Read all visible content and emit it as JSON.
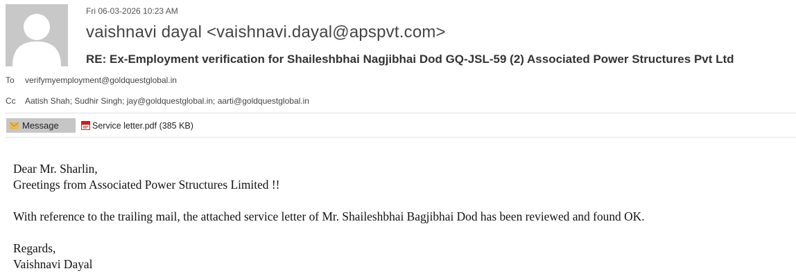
{
  "email": {
    "date": "Fri 06-03-2026 10:23 AM",
    "sender": "vaishnavi dayal <vaishnavi.dayal@apspvt.com>",
    "subject": "RE: Ex-Employment verification for Shaileshbhai Nagjibhai Dod GQ-JSL-59 (2) Associated Power Structures Pvt Ltd",
    "to_label": "To",
    "to": "verifymyemployment@goldquestglobal.in",
    "cc_label": "Cc",
    "cc": "Aatish Shah; Sudhir Singh; jay@goldquestglobal.in; aarti@goldquestglobal.in"
  },
  "tabs": {
    "message_label": "Message",
    "message_icon": "envelope-icon",
    "attachment_label": "Service letter.pdf (385 KB)",
    "attachment_icon": "pdf-icon"
  },
  "body": {
    "greeting": "Dear Mr. Sharlin,",
    "line2": "Greetings from Associated Power Structures Limited !!",
    "line3": "With reference to the trailing mail, the attached service letter of Mr. Shaileshbhai Bagjibhai Dod has been reviewed and found OK.",
    "closing": "Regards,",
    "signature": "Vaishnavi Dayal"
  },
  "colors": {
    "avatar_bg": "#c8c8c8",
    "avatar_fg": "#ffffff",
    "tab_selected_bg": "#c6c6c6",
    "envelope": "#e6b85c",
    "pdf_red": "#c8201d"
  }
}
